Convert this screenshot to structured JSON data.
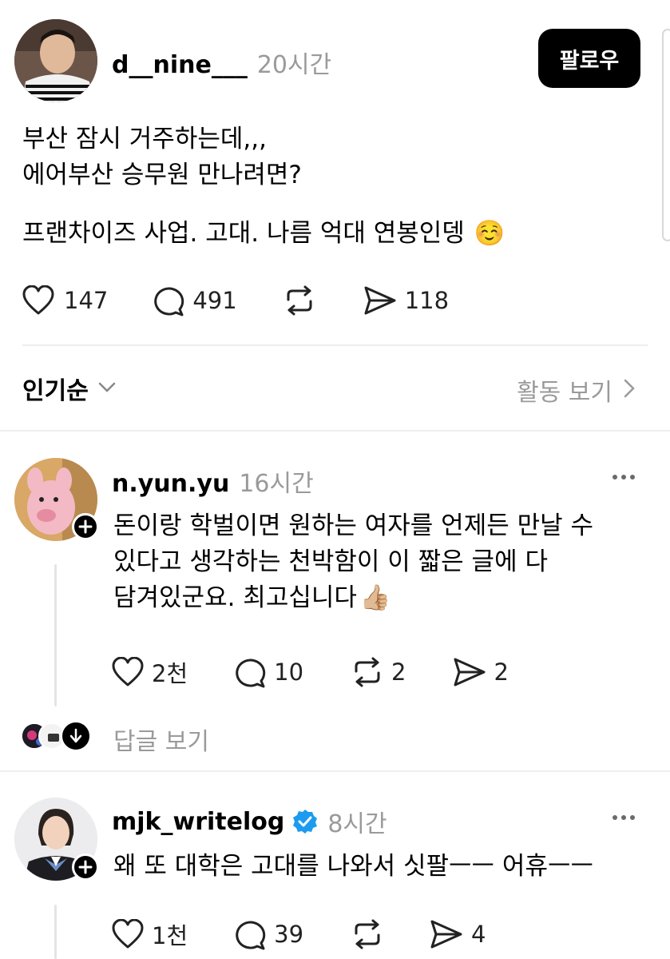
{
  "post": {
    "username": "d__nine___",
    "time": "20시간",
    "follow_label": "팔로우",
    "lines": [
      "부산 잠시 거주하는데,,,",
      "에어부산 승무원 만나려면?"
    ],
    "line3": "프랜차이즈 사업. 고대. 나름 억대 연봉인뎅",
    "emoji": "☺️",
    "likes": "147",
    "comments": "491",
    "shares": "118"
  },
  "sort": {
    "label": "인기순",
    "activity_label": "활동 보기"
  },
  "replies": [
    {
      "username": "n.yun.yu",
      "time": "16시간",
      "lines": [
        "돈이랑 학벌이면 원하는 여자를 언제든 만날 수",
        "있다고 생각하는 천박함이 이 짧은 글에 다",
        "담겨있군요. 최고십니다"
      ],
      "emoji": "👍🏼",
      "likes": "2천",
      "comments": "10",
      "reposts": "2",
      "shares": "2",
      "view_replies": "답글 보기"
    },
    {
      "username": "mjk_writelog",
      "time": "8시간",
      "lines": [
        "왜 또 대학은 고대를 나와서 싯팔ㅡㅡ  어휴ㅡㅡ"
      ],
      "likes": "1천",
      "comments": "39",
      "shares": "4"
    }
  ],
  "icons": {
    "like": "heart-icon",
    "comment": "comment-icon",
    "repost": "repost-icon",
    "share": "send-icon",
    "more": "more-icon",
    "verified": "verified-badge-icon"
  },
  "colors": {
    "follow_bg": "#000000",
    "secondary_text": "#9a9a9a",
    "verified": "#1d9bf0"
  }
}
